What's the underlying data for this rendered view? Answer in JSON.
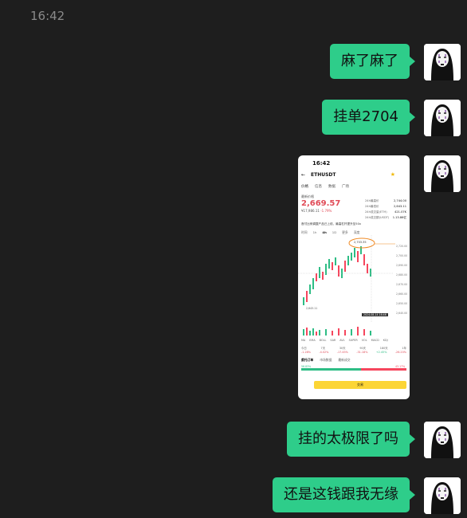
{
  "time_header": "16:42",
  "messages": [
    {
      "type": "text",
      "text": "麻了麻了"
    },
    {
      "type": "text",
      "text": "挂单2704"
    },
    {
      "type": "image"
    },
    {
      "type": "text",
      "text": "挂的太极限了吗"
    },
    {
      "type": "text",
      "text": "还是这钱跟我无缘"
    }
  ],
  "screenshot": {
    "status_time": "16:42",
    "pair": "ETHUSDT",
    "price": "2,669.57",
    "sub_price": "¥17,986.11",
    "change": "-1.79%",
    "price_label": "最新价格",
    "tabs": [
      "价格",
      "信息",
      "数据",
      "广场"
    ],
    "stats": [
      {
        "label": "24h最高价",
        "value": "2,744.00"
      },
      {
        "label": "24h最低价",
        "value": "2,643.11"
      },
      {
        "label": "24h成交量(ETH)",
        "value": "421.07K"
      },
      {
        "label": "24h成交额(USDT)",
        "value": "1.13.86亿"
      }
    ],
    "notice": "首付比例调整产品已上线，最高杠杆提升至50x",
    "intervals": [
      "时间",
      "1h",
      "4h",
      "1D",
      "更多",
      "深度"
    ],
    "order_price": "2,703.35",
    "y_ticks": [
      "2,720.00",
      "2,700.00",
      "2,690.00",
      "2,680.00",
      "2,670.00",
      "2,660.00",
      "2,650.00",
      "2,640.00"
    ],
    "low_label": "2,643.11",
    "indicators": [
      "MA",
      "EMA",
      "BOLL",
      "SAR",
      "AVL",
      "SUPER",
      "VOL",
      "MACD",
      "KDJ"
    ],
    "changes": [
      "今日",
      "7天",
      "30天",
      "90天",
      "180天",
      "1年"
    ],
    "change_vals": [
      "-1.28%",
      "-4.02%",
      "-17.45%",
      "-31.18%",
      "+2.45%",
      "-26.20%"
    ],
    "order_tabs": [
      "委托订单",
      "市场数据",
      "最新成交"
    ],
    "buy_label": "56.83%",
    "sell_label": "43.17%",
    "trade_button": "交易",
    "chart_caption": "2024-08-14 16:46"
  }
}
